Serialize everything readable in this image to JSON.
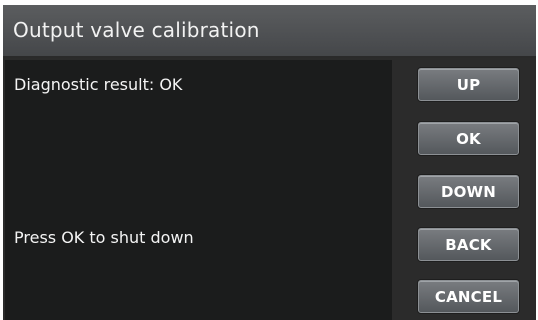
{
  "title": "Output valve calibration",
  "content": {
    "result_text": "Diagnostic result: OK",
    "prompt_text": "Press OK to shut down"
  },
  "buttons": {
    "up": "UP",
    "ok": "OK",
    "down": "DOWN",
    "back": "BACK",
    "cancel": "CANCEL"
  }
}
